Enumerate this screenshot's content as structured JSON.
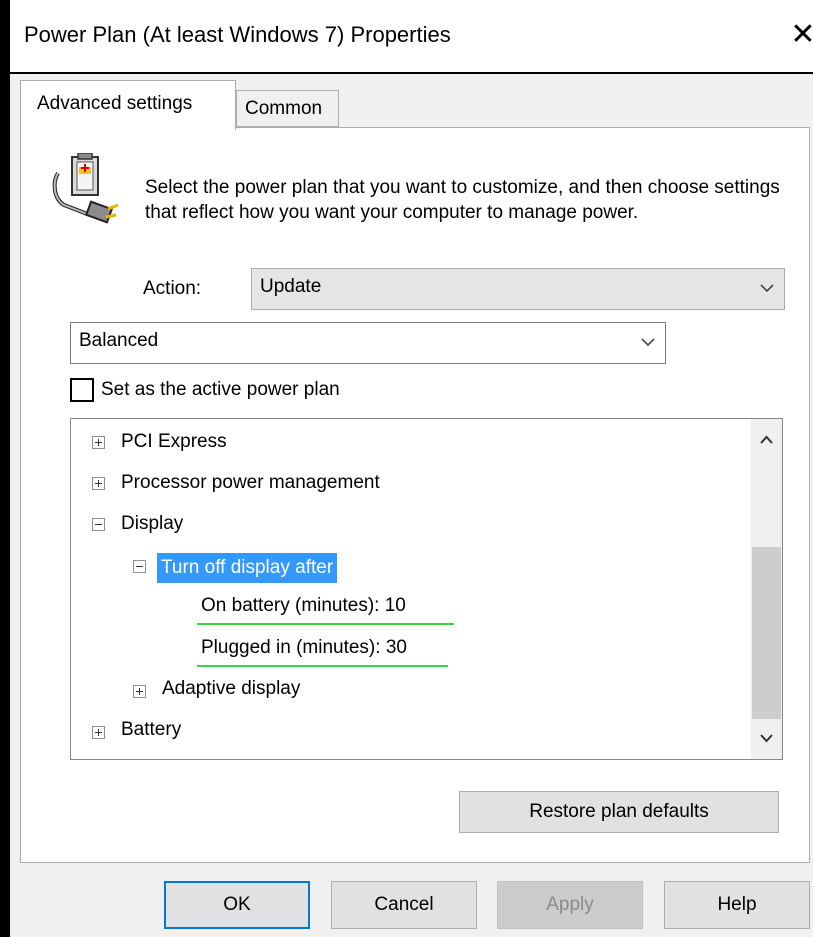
{
  "window": {
    "title": "Power Plan (At least Windows 7) Properties",
    "close_glyph": "✕"
  },
  "tabs": [
    {
      "label": "Advanced settings",
      "active": true
    },
    {
      "label": "Common",
      "active": false
    }
  ],
  "description": "Select the power plan that you want to customize, and then choose settings that reflect how you want your computer to manage power.",
  "action": {
    "label": "Action:",
    "value": "Update"
  },
  "plan": {
    "value": "Balanced"
  },
  "active_checkbox": {
    "label": "Set as the active power plan",
    "checked": false
  },
  "tree": {
    "items": [
      {
        "label": "PCI Express",
        "state": "collapsed"
      },
      {
        "label": "Processor power management",
        "state": "collapsed"
      },
      {
        "label": "Display",
        "state": "expanded"
      },
      {
        "label": "Turn off display after",
        "state": "expanded",
        "selected": true
      },
      {
        "label": "On battery (minutes): 10"
      },
      {
        "label": "Plugged in (minutes): 30"
      },
      {
        "label": "Adaptive display",
        "state": "collapsed"
      },
      {
        "label": "Battery",
        "state": "collapsed"
      }
    ]
  },
  "buttons": {
    "restore": "Restore plan defaults",
    "ok": "OK",
    "cancel": "Cancel",
    "apply": "Apply",
    "help": "Help"
  },
  "colors": {
    "selection": "#3399ff",
    "highlight_underline": "#3cd33c",
    "default_button_border": "#0078d7"
  },
  "icons": [
    "power-plan-icon",
    "chevron-down-icon",
    "plus-box-icon",
    "minus-box-icon",
    "chevron-up-icon",
    "close-icon"
  ]
}
